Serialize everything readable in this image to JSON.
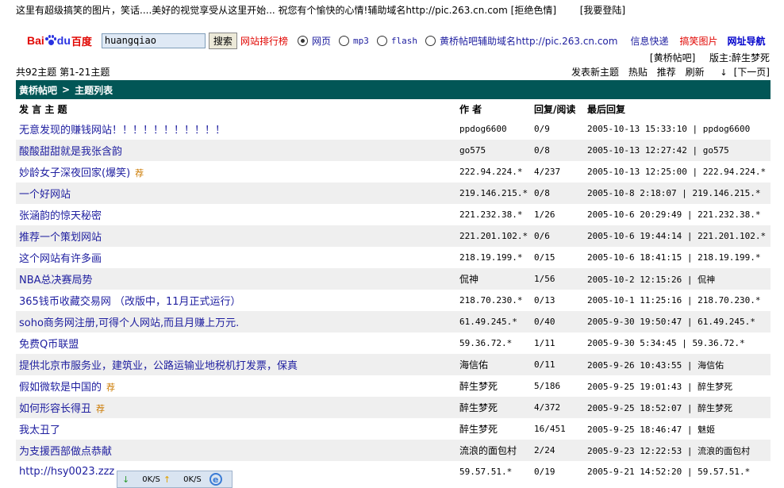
{
  "topbar": {
    "promo": "这里有超级搞笑的图片，笑话....美好的视觉享受从这里开始...  祝您有个愉快的心情!辅助域名http://pic.263.cn.com",
    "refuse": "[拒绝色情]",
    "login": "[我要登陆]"
  },
  "search": {
    "logo_bai": "Bai",
    "logo_du": "du",
    "logo_cn": "百度",
    "query": "huangqiao",
    "button": "搜索",
    "rank_link": "网站排行榜",
    "options": [
      {
        "label": "网页",
        "selected": true
      },
      {
        "label": "mp3",
        "selected": false
      },
      {
        "label": "flash",
        "selected": false
      },
      {
        "label": "黄桥帖吧辅助域名http://pic.263.cn.com",
        "selected": false
      }
    ],
    "quick_news": "信息快递",
    "funny_pics": "搞笑图片",
    "nav": "网址导航"
  },
  "bar": {
    "name": "[黄桥帖吧]",
    "moderator": "版主:醉生梦死",
    "count": "共92主题 第1-21主题",
    "actions": [
      "发表新主题",
      "热贴",
      "推荐",
      "刷新"
    ],
    "next": "[下一页]",
    "crumb_root": "黄桥帖吧",
    "crumb_sep": ">",
    "crumb_current": "主题列表"
  },
  "table": {
    "headers": [
      "发 言 主 题",
      "作 者",
      "回复/阅读",
      "最后回复"
    ],
    "recommend_label": "荐",
    "rows": [
      {
        "title": "无意发现的赚钱网站！！！！！！！！！！！",
        "rec": false,
        "author": "ppdog6600",
        "replies": "0/9",
        "last": "2005-10-13 15:33:10 | ppdog6600"
      },
      {
        "title": "酸酸甜甜就是我张含韵",
        "rec": false,
        "author": "go575",
        "replies": "0/8",
        "last": "2005-10-13 12:27:42 | go575"
      },
      {
        "title": "妙龄女子深夜回家(爆笑)",
        "rec": true,
        "author": "222.94.224.*",
        "replies": "4/237",
        "last": "2005-10-13 12:25:00 | 222.94.224.*"
      },
      {
        "title": "一个好网站",
        "rec": false,
        "author": "219.146.215.*",
        "replies": "0/8",
        "last": "2005-10-8 2:18:07 | 219.146.215.*"
      },
      {
        "title": "张涵韵的惊天秘密",
        "rec": false,
        "author": "221.232.38.*",
        "replies": "1/26",
        "last": "2005-10-6 20:29:49 | 221.232.38.*"
      },
      {
        "title": "推荐一个策划网站",
        "rec": false,
        "author": "221.201.102.*",
        "replies": "0/6",
        "last": "2005-10-6 19:44:14 | 221.201.102.*"
      },
      {
        "title": "这个网站有许多画",
        "rec": false,
        "author": "218.19.199.*",
        "replies": "0/15",
        "last": "2005-10-6 18:41:15 | 218.19.199.*"
      },
      {
        "title": "NBA总决赛局势",
        "rec": false,
        "author": "侃神",
        "replies": "1/56",
        "last": "2005-10-2 12:15:26 | 侃神"
      },
      {
        "title": "365钱币收藏交易网 （改版中，11月正式运行）",
        "rec": false,
        "author": "218.70.230.*",
        "replies": "0/13",
        "last": "2005-10-1 11:25:16 | 218.70.230.*"
      },
      {
        "title": "soho商务网注册,可得个人网站,而且月赚上万元.",
        "rec": false,
        "author": "61.49.245.*",
        "replies": "0/40",
        "last": "2005-9-30 19:50:47 | 61.49.245.*"
      },
      {
        "title": "免费Q币联盟",
        "rec": false,
        "author": "59.36.72.*",
        "replies": "1/11",
        "last": "2005-9-30 5:34:45 | 59.36.72.*"
      },
      {
        "title": "提供北京市服务业，建筑业，公路运输业地税机打发票，保真",
        "rec": false,
        "author": "海信佑",
        "replies": "0/11",
        "last": "2005-9-26 10:43:55 | 海信佑"
      },
      {
        "title": "假如微软是中国的",
        "rec": true,
        "author": "醉生梦死",
        "replies": "5/186",
        "last": "2005-9-25 19:01:43 | 醉生梦死"
      },
      {
        "title": "如何形容长得丑",
        "rec": true,
        "author": "醉生梦死",
        "replies": "4/372",
        "last": "2005-9-25 18:52:07 | 醉生梦死"
      },
      {
        "title": "我太丑了",
        "rec": false,
        "author": "醉生梦死",
        "replies": "16/451",
        "last": "2005-9-25 18:46:47 | 魅姬"
      },
      {
        "title": "为支援西部做点恭献",
        "rec": false,
        "author": "流浪的面包村",
        "replies": "2/24",
        "last": "2005-9-23 12:22:53 | 流浪的面包村"
      },
      {
        "title": "http://hsy0023.zzz",
        "rec": false,
        "author": "59.57.51.*",
        "replies": "0/19",
        "last": "2005-9-21 14:52:20 | 59.57.51.*"
      }
    ]
  },
  "status": {
    "down": "0K/S",
    "up": "0K/S"
  }
}
